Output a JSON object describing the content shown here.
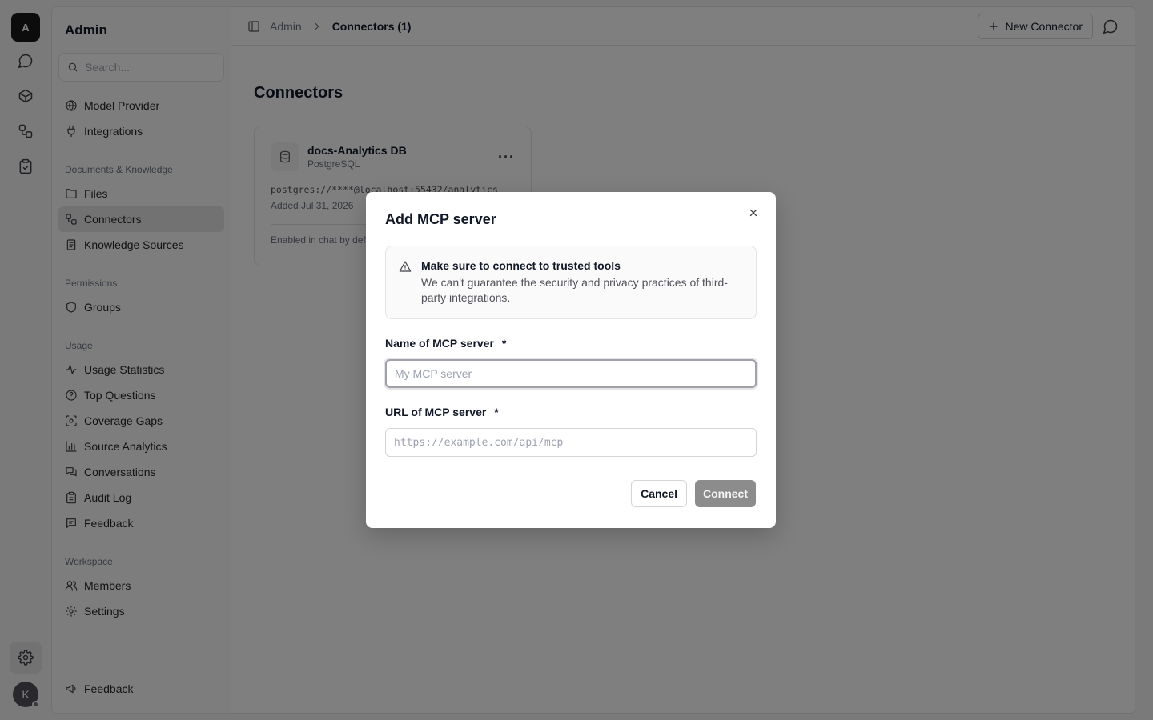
{
  "rail": {
    "logo_letter": "A",
    "avatar_letter": "K",
    "icons": [
      "chat-icon",
      "cube-icon",
      "workflow-icon",
      "clipboard-check-icon",
      "settings-icon"
    ]
  },
  "sidebar": {
    "title": "Admin",
    "search_placeholder": "Search...",
    "top_items": [
      {
        "label": "Model Provider",
        "icon": "globe-icon"
      },
      {
        "label": "Integrations",
        "icon": "plug-icon"
      }
    ],
    "sections": [
      {
        "heading": "Documents & Knowledge",
        "items": [
          {
            "label": "Files",
            "icon": "folder-icon"
          },
          {
            "label": "Connectors",
            "icon": "workflow-icon",
            "active": true
          },
          {
            "label": "Knowledge Sources",
            "icon": "book-icon"
          }
        ]
      },
      {
        "heading": "Permissions",
        "items": [
          {
            "label": "Groups",
            "icon": "shield-icon"
          }
        ]
      },
      {
        "heading": "Usage",
        "items": [
          {
            "label": "Usage Statistics",
            "icon": "activity-icon"
          },
          {
            "label": "Top Questions",
            "icon": "help-circle-icon"
          },
          {
            "label": "Coverage Gaps",
            "icon": "scan-icon"
          },
          {
            "label": "Source Analytics",
            "icon": "bar-chart-icon"
          },
          {
            "label": "Conversations",
            "icon": "messages-icon"
          },
          {
            "label": "Audit Log",
            "icon": "clipboard-icon"
          },
          {
            "label": "Feedback",
            "icon": "message-square-icon"
          }
        ]
      },
      {
        "heading": "Workspace",
        "items": [
          {
            "label": "Members",
            "icon": "users-icon"
          },
          {
            "label": "Settings",
            "icon": "gear-icon"
          }
        ]
      }
    ],
    "bottom_item": {
      "label": "Feedback",
      "icon": "megaphone-icon"
    }
  },
  "topbar": {
    "crumb_root": "Admin",
    "crumb_current": "Connectors (1)",
    "new_button": "New Connector"
  },
  "page": {
    "title": "Connectors",
    "card": {
      "name": "docs-Analytics DB",
      "type": "PostgreSQL",
      "connection": "postgres://****@localhost:55432/analytics",
      "added": "Added Jul 31, 2026",
      "footer": "Enabled in chat by default"
    }
  },
  "modal": {
    "title": "Add MCP server",
    "warning_title": "Make sure to connect to trusted tools",
    "warning_body": "We can't guarantee the security and privacy practices of third-party integrations.",
    "name_label": "Name of MCP server",
    "name_placeholder": "My MCP server",
    "url_label": "URL of MCP server",
    "url_placeholder": "https://example.com/api/mcp",
    "required_mark": "*",
    "cancel": "Cancel",
    "connect": "Connect"
  }
}
